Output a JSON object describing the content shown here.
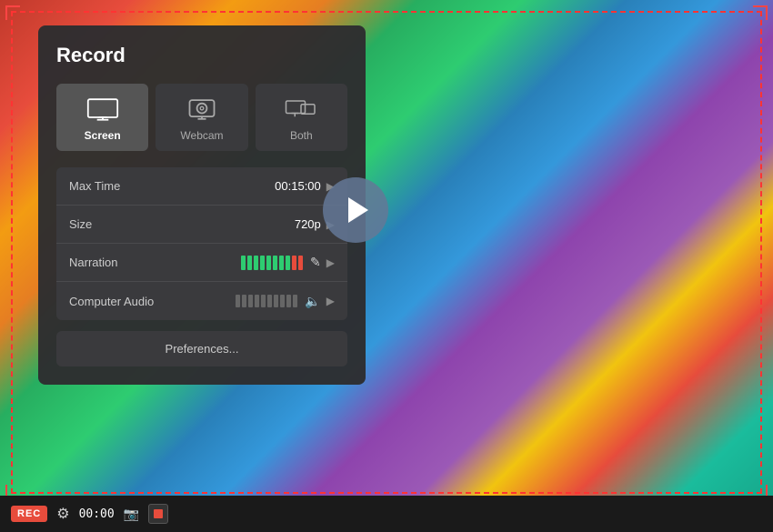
{
  "panel": {
    "title": "Record",
    "modes": [
      {
        "id": "screen",
        "label": "Screen",
        "active": true
      },
      {
        "id": "webcam",
        "label": "Webcam",
        "active": false
      },
      {
        "id": "both",
        "label": "Both",
        "active": false
      }
    ],
    "settings": [
      {
        "label": "Max Time",
        "value": "00:15:00"
      },
      {
        "label": "Size",
        "value": "720p"
      },
      {
        "label": "Narration",
        "value": ""
      },
      {
        "label": "Computer Audio",
        "value": ""
      }
    ],
    "preferences_label": "Preferences..."
  },
  "toolbar": {
    "rec_label": "REC",
    "timer": "00:00",
    "gear_symbol": "⚙",
    "camera_symbol": "🎥"
  },
  "narration_bars": [
    "green",
    "green",
    "green",
    "green",
    "green",
    "green",
    "green",
    "green",
    "red",
    "red"
  ],
  "audio_bars_count": 10
}
